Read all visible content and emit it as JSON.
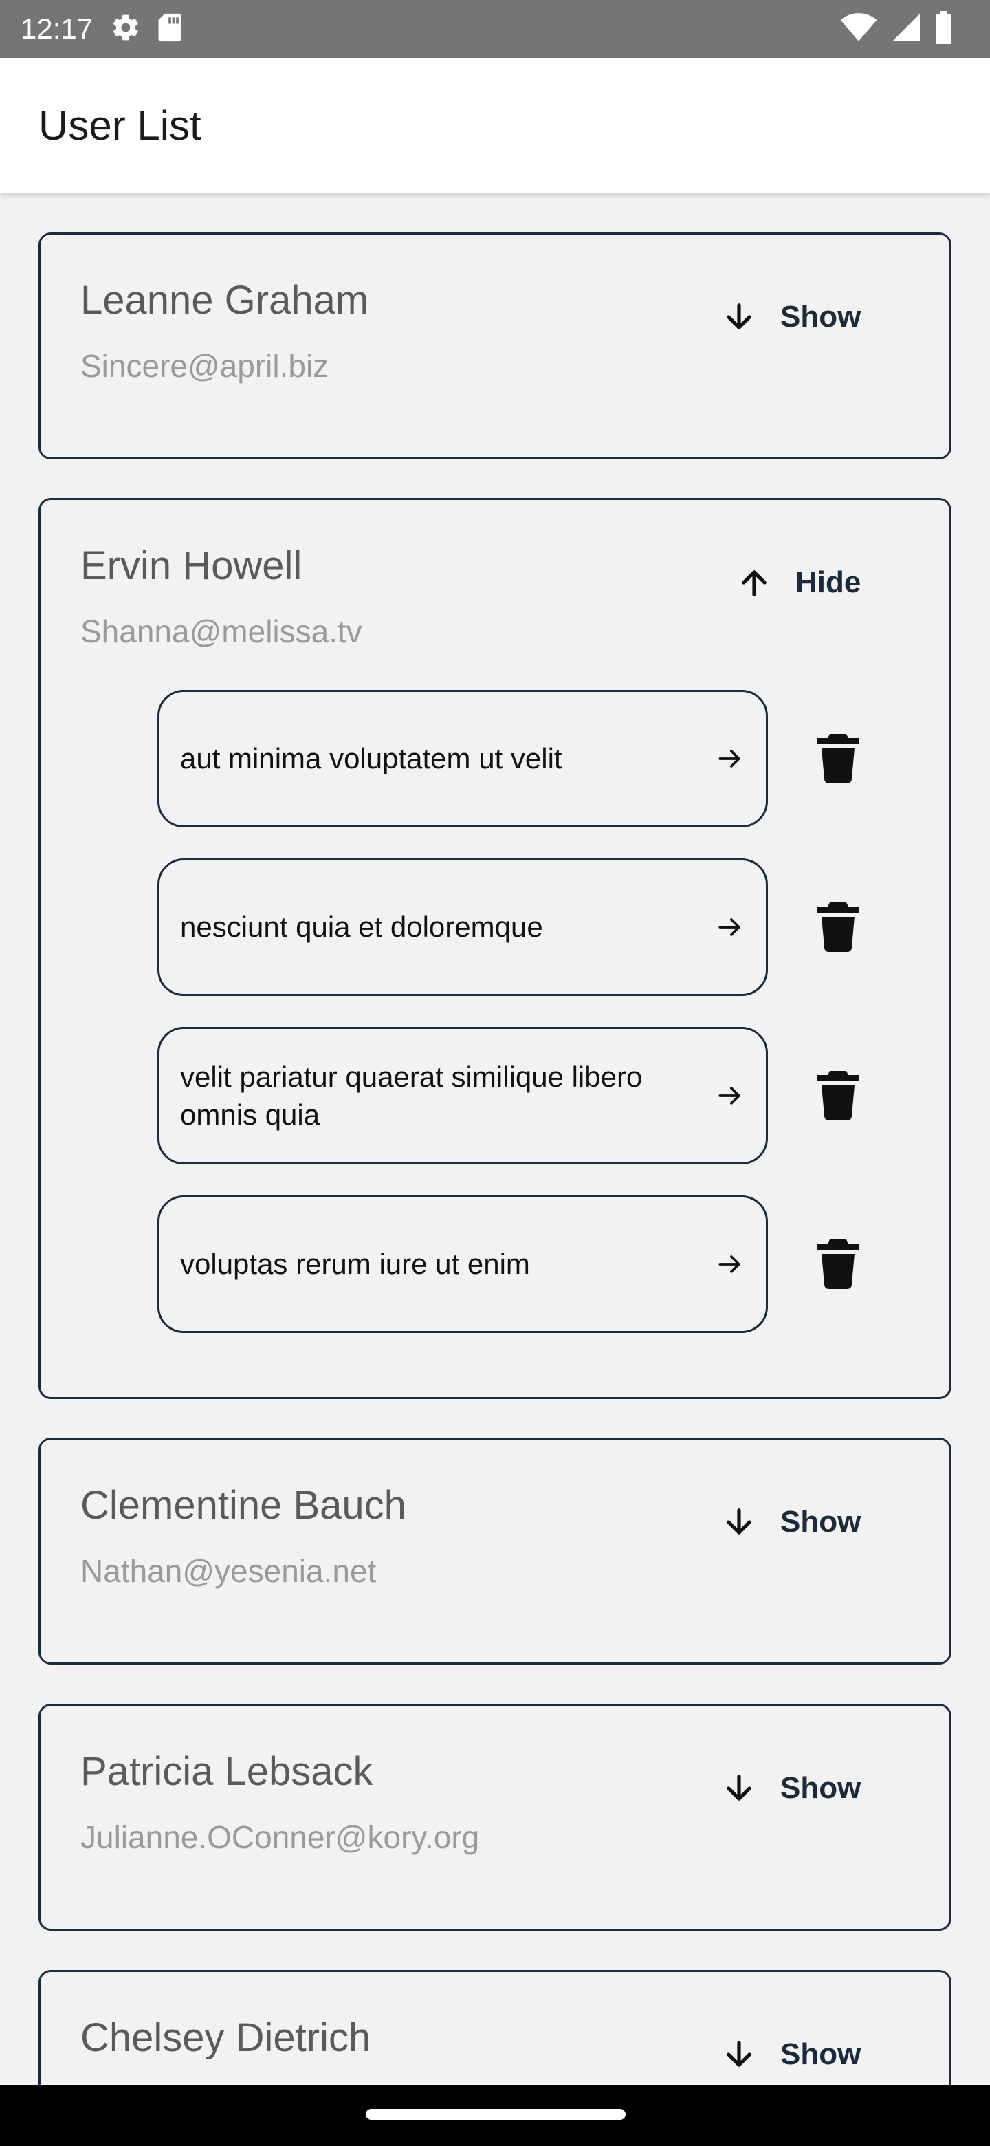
{
  "status_bar": {
    "time": "12:17",
    "left_icons": [
      "gear-icon",
      "sd-card-icon"
    ],
    "right_icons": [
      "wifi-icon",
      "signal-icon",
      "battery-icon"
    ]
  },
  "app_bar": {
    "title": "User List"
  },
  "users": [
    {
      "name": "Leanne Graham",
      "email": "Sincere@april.biz",
      "toggle_label": "Show",
      "expanded": false
    },
    {
      "name": "Ervin Howell",
      "email": "Shanna@melissa.tv",
      "toggle_label": "Hide",
      "expanded": true,
      "posts": [
        {
          "title": "aut minima voluptatem ut velit"
        },
        {
          "title": "nesciunt quia et doloremque"
        },
        {
          "title": "velit pariatur quaerat similique libero omnis quia"
        },
        {
          "title": "voluptas rerum iure ut enim"
        }
      ]
    },
    {
      "name": "Clementine Bauch",
      "email": "Nathan@yesenia.net",
      "toggle_label": "Show",
      "expanded": false
    },
    {
      "name": "Patricia Lebsack",
      "email": "Julianne.OConner@kory.org",
      "toggle_label": "Show",
      "expanded": false
    },
    {
      "name": "Chelsey Dietrich",
      "email": "",
      "toggle_label": "Show",
      "expanded": false
    }
  ],
  "colors": {
    "status_bar_bg": "#757575",
    "background": "#f2f2f2",
    "border": "#1c2a3a",
    "name_text": "#5a5a5a",
    "email_text": "#9a9a9a"
  }
}
